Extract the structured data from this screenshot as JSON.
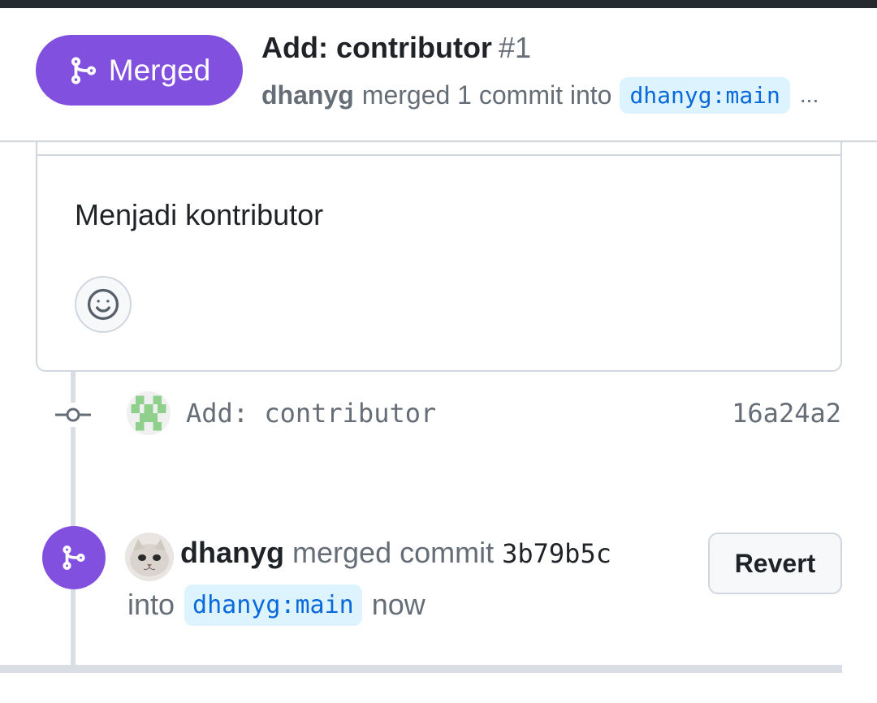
{
  "header": {
    "status_label": "Merged",
    "status_icon": "git-merge-icon",
    "title": "Add: contributor",
    "number": "#1",
    "author": "dhanyg",
    "summary": "merged 1 commit into",
    "base_branch": "dhanyg:main",
    "overflow": "..."
  },
  "comment": {
    "body": "Menjadi kontributor",
    "reaction_icon": "smiley-icon"
  },
  "timeline": {
    "commit": {
      "message": "Add: contributor",
      "sha": "16a24a2",
      "icon": "git-commit-icon"
    },
    "merge_event": {
      "author": "dhanyg",
      "action": "merged commit",
      "sha": "3b79b5c",
      "into_label": "into",
      "branch": "dhanyg:main",
      "time": "now",
      "revert_label": "Revert",
      "icon": "git-merge-icon"
    }
  },
  "colors": {
    "merged_purple": "#8250df",
    "branch_bg": "#ddf4ff",
    "branch_fg": "#0969da",
    "muted": "#656d76"
  }
}
